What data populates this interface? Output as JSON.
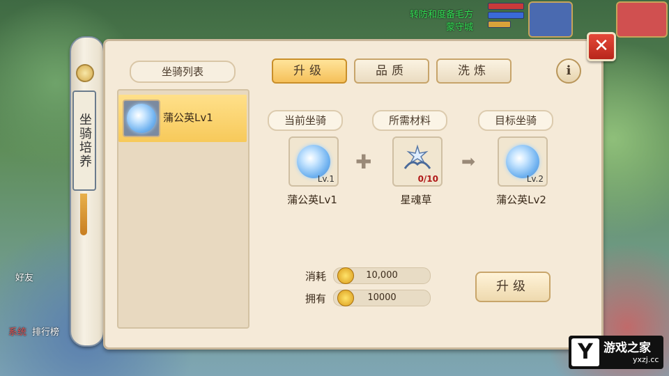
{
  "hud": {
    "top_text_1": "转防和度备毛方",
    "top_text_2": "蒙守城",
    "bottom_tab_1": "系统",
    "bottom_tab_2": "排行榜",
    "side_label_friends": "好友"
  },
  "scroll": {
    "title": "坐骑培养"
  },
  "list": {
    "header": "坐骑列表",
    "items": [
      {
        "label": "蒲公英Lv1"
      }
    ]
  },
  "tabs": [
    {
      "label": "升级",
      "active": true
    },
    {
      "label": "品质",
      "active": false
    },
    {
      "label": "洗炼",
      "active": false
    }
  ],
  "info_label": "i",
  "close_label": "✕",
  "sections": {
    "current": {
      "label": "当前坐骑",
      "name": "蒲公英Lv1",
      "level": "Lv.1"
    },
    "material": {
      "label": "所需材料",
      "name": "星魂草",
      "count": "0/10"
    },
    "target": {
      "label": "目标坐骑",
      "name": "蒲公英Lv2",
      "level": "Lv.2"
    }
  },
  "cost": {
    "consume_label": "消耗",
    "consume_value": "10,000",
    "owned_label": "拥有",
    "owned_value": "10000"
  },
  "upgrade_button": "升级",
  "watermark": {
    "brand": "游戏之家",
    "url": "yxzj.cc",
    "logo": "Y"
  }
}
